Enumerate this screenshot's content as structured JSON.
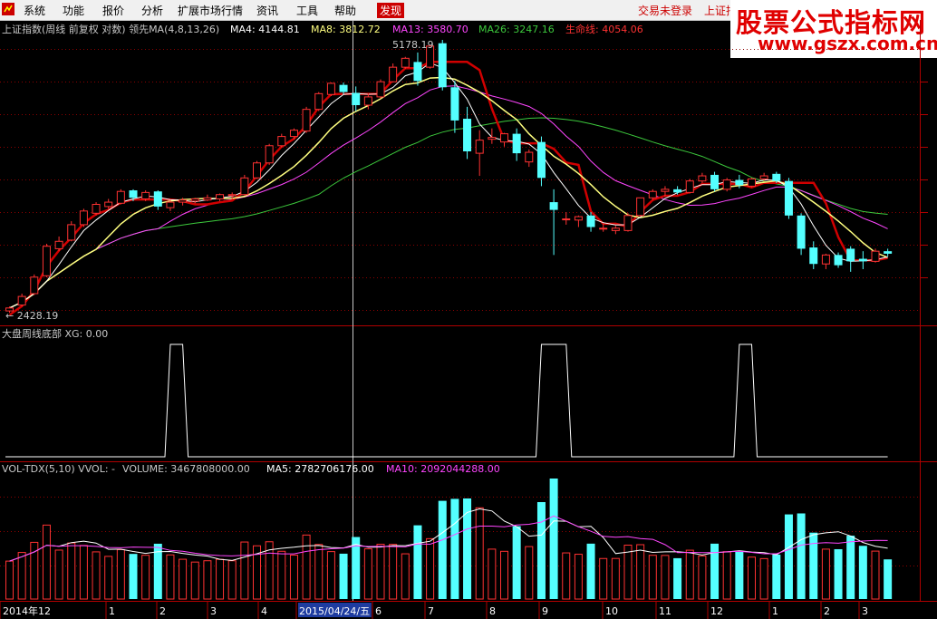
{
  "menu": {
    "items": [
      "系统",
      "功能",
      "报价",
      "分析",
      "扩展市场行情",
      "资讯",
      "工具",
      "帮助"
    ],
    "highlight": "发现",
    "login": "交易未登录",
    "index_link": "上证指"
  },
  "watermark": {
    "line1": "股票公式指标网",
    "line2": "www.gszx.com.cn"
  },
  "colors": {
    "up": "#ff3232",
    "down": "#54ffff",
    "ma4": "#ffffff",
    "ma8": "#ffff80",
    "ma13": "#ff46ff",
    "ma26": "#3cc83c",
    "life": "#d00000",
    "axis": "#b00000"
  },
  "main_panel": {
    "header": {
      "title": "上证指数(周线 前复权 对数) 领先MA(4,8,13,26)",
      "ma4": "MA4: 4144.81",
      "ma8": "MA8: 3812.72",
      "ma13": "MA13: 3580.70",
      "ma26": "MA26: 3247.16",
      "life": "生命线: 4054.06"
    },
    "high_label": "5178.19",
    "low_label": "← 2428.19"
  },
  "indicator_panel": {
    "header": "大盘周线底部 XG: 0.00"
  },
  "volume_panel": {
    "header": {
      "title": "VOL-TDX(5,10) VVOL: -",
      "volume": "VOLUME: 3467808000.00",
      "ma5": "MA5: 2782706176.00",
      "ma10": "MA10: 2092044288.00"
    }
  },
  "x_axis": {
    "labels": [
      "2014年12",
      "1",
      "2",
      "3",
      "4",
      "2015/04/24/五",
      "6",
      "7",
      "8",
      "9",
      "10",
      "11",
      "12",
      "1",
      "2",
      "3"
    ]
  },
  "chart_data": {
    "type": "candlestick",
    "title": "上证指数(周线 前复权 对数)",
    "price_range": [
      2428.19,
      5178.19
    ],
    "candles": [
      {
        "o": 2440,
        "h": 2470,
        "l": 2428,
        "c": 2460
      },
      {
        "o": 2480,
        "h": 2560,
        "l": 2470,
        "c": 2540
      },
      {
        "o": 2560,
        "h": 2700,
        "l": 2550,
        "c": 2680
      },
      {
        "o": 2690,
        "h": 2940,
        "l": 2680,
        "c": 2920
      },
      {
        "o": 2900,
        "h": 3000,
        "l": 2880,
        "c": 2960
      },
      {
        "o": 2970,
        "h": 3130,
        "l": 2960,
        "c": 3100
      },
      {
        "o": 3100,
        "h": 3240,
        "l": 3080,
        "c": 3220
      },
      {
        "o": 3200,
        "h": 3300,
        "l": 3180,
        "c": 3280
      },
      {
        "o": 3260,
        "h": 3330,
        "l": 3240,
        "c": 3300
      },
      {
        "o": 3290,
        "h": 3420,
        "l": 3280,
        "c": 3400
      },
      {
        "o": 3410,
        "h": 3420,
        "l": 3310,
        "c": 3340
      },
      {
        "o": 3330,
        "h": 3410,
        "l": 3310,
        "c": 3390
      },
      {
        "o": 3400,
        "h": 3410,
        "l": 3230,
        "c": 3260
      },
      {
        "o": 3250,
        "h": 3320,
        "l": 3220,
        "c": 3300
      },
      {
        "o": 3300,
        "h": 3340,
        "l": 3270,
        "c": 3320
      },
      {
        "o": 3310,
        "h": 3340,
        "l": 3290,
        "c": 3330
      },
      {
        "o": 3320,
        "h": 3370,
        "l": 3310,
        "c": 3340
      },
      {
        "o": 3330,
        "h": 3380,
        "l": 3310,
        "c": 3370
      },
      {
        "o": 3360,
        "h": 3390,
        "l": 3330,
        "c": 3370
      },
      {
        "o": 3370,
        "h": 3560,
        "l": 3360,
        "c": 3530
      },
      {
        "o": 3530,
        "h": 3700,
        "l": 3520,
        "c": 3680
      },
      {
        "o": 3680,
        "h": 3880,
        "l": 3660,
        "c": 3860
      },
      {
        "o": 3860,
        "h": 3990,
        "l": 3840,
        "c": 3960
      },
      {
        "o": 3960,
        "h": 4050,
        "l": 3930,
        "c": 4030
      },
      {
        "o": 4020,
        "h": 4300,
        "l": 4000,
        "c": 4270
      },
      {
        "o": 4270,
        "h": 4480,
        "l": 4250,
        "c": 4460
      },
      {
        "o": 4450,
        "h": 4600,
        "l": 4430,
        "c": 4590
      },
      {
        "o": 4570,
        "h": 4600,
        "l": 4450,
        "c": 4480
      },
      {
        "o": 4470,
        "h": 4550,
        "l": 4250,
        "c": 4320
      },
      {
        "o": 4320,
        "h": 4460,
        "l": 4270,
        "c": 4420
      },
      {
        "o": 4420,
        "h": 4640,
        "l": 4400,
        "c": 4610
      },
      {
        "o": 4610,
        "h": 4850,
        "l": 4600,
        "c": 4800
      },
      {
        "o": 4800,
        "h": 4940,
        "l": 4780,
        "c": 4920
      },
      {
        "o": 4870,
        "h": 5000,
        "l": 4560,
        "c": 4620
      },
      {
        "o": 4800,
        "h": 5100,
        "l": 4780,
        "c": 5090
      },
      {
        "o": 5130,
        "h": 5178,
        "l": 4500,
        "c": 4540
      },
      {
        "o": 4540,
        "h": 4620,
        "l": 4000,
        "c": 4140
      },
      {
        "o": 4160,
        "h": 4300,
        "l": 3720,
        "c": 3800
      },
      {
        "o": 3780,
        "h": 4030,
        "l": 3550,
        "c": 3920
      },
      {
        "o": 3930,
        "h": 4050,
        "l": 3880,
        "c": 3950
      },
      {
        "o": 3900,
        "h": 4000,
        "l": 3850,
        "c": 3990
      },
      {
        "o": 3990,
        "h": 4050,
        "l": 3700,
        "c": 3780
      },
      {
        "o": 3690,
        "h": 3820,
        "l": 3640,
        "c": 3790
      },
      {
        "o": 3900,
        "h": 3960,
        "l": 3450,
        "c": 3530
      },
      {
        "o": 3300,
        "h": 3420,
        "l": 2850,
        "c": 3230
      },
      {
        "o": 3150,
        "h": 3210,
        "l": 3100,
        "c": 3150
      },
      {
        "o": 3140,
        "h": 3180,
        "l": 3080,
        "c": 3170
      },
      {
        "o": 3180,
        "h": 3210,
        "l": 3040,
        "c": 3080
      },
      {
        "o": 3070,
        "h": 3110,
        "l": 3040,
        "c": 3070
      },
      {
        "o": 3050,
        "h": 3090,
        "l": 3020,
        "c": 3070
      },
      {
        "o": 3050,
        "h": 3200,
        "l": 3040,
        "c": 3180
      },
      {
        "o": 3180,
        "h": 3340,
        "l": 3170,
        "c": 3340
      },
      {
        "o": 3340,
        "h": 3420,
        "l": 3320,
        "c": 3400
      },
      {
        "o": 3400,
        "h": 3450,
        "l": 3350,
        "c": 3420
      },
      {
        "o": 3420,
        "h": 3450,
        "l": 3370,
        "c": 3390
      },
      {
        "o": 3390,
        "h": 3520,
        "l": 3380,
        "c": 3500
      },
      {
        "o": 3500,
        "h": 3580,
        "l": 3480,
        "c": 3550
      },
      {
        "o": 3560,
        "h": 3590,
        "l": 3400,
        "c": 3420
      },
      {
        "o": 3420,
        "h": 3530,
        "l": 3400,
        "c": 3510
      },
      {
        "o": 3510,
        "h": 3560,
        "l": 3430,
        "c": 3460
      },
      {
        "o": 3450,
        "h": 3530,
        "l": 3440,
        "c": 3520
      },
      {
        "o": 3520,
        "h": 3580,
        "l": 3500,
        "c": 3550
      },
      {
        "o": 3570,
        "h": 3590,
        "l": 3480,
        "c": 3500
      },
      {
        "o": 3500,
        "h": 3530,
        "l": 3150,
        "c": 3180
      },
      {
        "o": 3180,
        "h": 3200,
        "l": 2850,
        "c": 2900
      },
      {
        "o": 2910,
        "h": 2960,
        "l": 2740,
        "c": 2780
      },
      {
        "o": 2780,
        "h": 2860,
        "l": 2740,
        "c": 2850
      },
      {
        "o": 2850,
        "h": 2870,
        "l": 2750,
        "c": 2770
      },
      {
        "o": 2900,
        "h": 2920,
        "l": 2720,
        "c": 2800
      },
      {
        "o": 2820,
        "h": 2880,
        "l": 2740,
        "c": 2800
      },
      {
        "o": 2800,
        "h": 2900,
        "l": 2790,
        "c": 2880
      },
      {
        "o": 2880,
        "h": 2900,
        "l": 2840,
        "c": 2860
      }
    ],
    "xg_signals": [
      {
        "start": 13,
        "end": 14
      },
      {
        "start": 43,
        "end": 45
      },
      {
        "start": 59,
        "end": 60
      }
    ],
    "volume_labels": {
      "volume": 3467808000.0,
      "ma5": 2782706176.0,
      "ma10": 2092044288.0
    }
  }
}
